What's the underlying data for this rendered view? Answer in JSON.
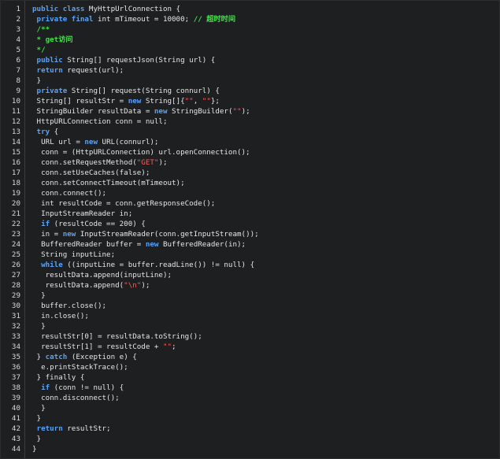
{
  "editor": {
    "lines": [
      [
        {
          "t": "public class",
          "c": "kw"
        },
        {
          "t": " MyHttpUrlConnection {",
          "c": "pl"
        }
      ],
      [
        {
          "t": " private final",
          "c": "kw"
        },
        {
          "t": " int mTimeout = 10000; ",
          "c": "pl"
        },
        {
          "t": "// 超时时间",
          "c": "cm"
        }
      ],
      [
        {
          "t": " /**",
          "c": "cm"
        }
      ],
      [
        {
          "t": " * get访问",
          "c": "cm"
        }
      ],
      [
        {
          "t": " */",
          "c": "cm"
        }
      ],
      [
        {
          "t": " public",
          "c": "kw"
        },
        {
          "t": " String[] requestJson(String url) {",
          "c": "pl"
        }
      ],
      [
        {
          "t": " return",
          "c": "kw"
        },
        {
          "t": " request(url);",
          "c": "pl"
        }
      ],
      [
        {
          "t": " }",
          "c": "pl"
        }
      ],
      [
        {
          "t": " private",
          "c": "kw"
        },
        {
          "t": " String[] request(String connurl) {",
          "c": "pl"
        }
      ],
      [
        {
          "t": " String[] resultStr = ",
          "c": "pl"
        },
        {
          "t": "new",
          "c": "kw"
        },
        {
          "t": " String[]{",
          "c": "pl"
        },
        {
          "t": "\"\"",
          "c": "st"
        },
        {
          "t": ", ",
          "c": "pl"
        },
        {
          "t": "\"\"",
          "c": "st"
        },
        {
          "t": "};",
          "c": "pl"
        }
      ],
      [
        {
          "t": " StringBuilder resultData = ",
          "c": "pl"
        },
        {
          "t": "new",
          "c": "kw"
        },
        {
          "t": " StringBuilder(",
          "c": "pl"
        },
        {
          "t": "\"\"",
          "c": "st"
        },
        {
          "t": ");",
          "c": "pl"
        }
      ],
      [
        {
          "t": " HttpURLConnection conn = null;",
          "c": "pl"
        }
      ],
      [
        {
          "t": " try",
          "c": "kw"
        },
        {
          "t": " {",
          "c": "pl"
        }
      ],
      [
        {
          "t": "  URL url = ",
          "c": "pl"
        },
        {
          "t": "new",
          "c": "kw"
        },
        {
          "t": " URL(connurl);",
          "c": "pl"
        }
      ],
      [
        {
          "t": "  conn = (HttpURLConnection) url.openConnection();",
          "c": "pl"
        }
      ],
      [
        {
          "t": "  conn.setRequestMethod(",
          "c": "pl"
        },
        {
          "t": "\"GET\"",
          "c": "st"
        },
        {
          "t": ");",
          "c": "pl"
        }
      ],
      [
        {
          "t": "  conn.setUseCaches(false);",
          "c": "pl"
        }
      ],
      [
        {
          "t": "  conn.setConnectTimeout(mTimeout);",
          "c": "pl"
        }
      ],
      [
        {
          "t": "  conn.connect();",
          "c": "pl"
        }
      ],
      [
        {
          "t": "  int resultCode = conn.getResponseCode();",
          "c": "pl"
        }
      ],
      [
        {
          "t": "  InputStreamReader in;",
          "c": "pl"
        }
      ],
      [
        {
          "t": "  if",
          "c": "kw"
        },
        {
          "t": " (resultCode == 200) {",
          "c": "pl"
        }
      ],
      [
        {
          "t": "  in = ",
          "c": "pl"
        },
        {
          "t": "new",
          "c": "kw"
        },
        {
          "t": " InputStreamReader(conn.getInputStream());",
          "c": "pl"
        }
      ],
      [
        {
          "t": "  BufferedReader buffer = ",
          "c": "pl"
        },
        {
          "t": "new",
          "c": "kw"
        },
        {
          "t": " BufferedReader(in);",
          "c": "pl"
        }
      ],
      [
        {
          "t": "  String inputLine;",
          "c": "pl"
        }
      ],
      [
        {
          "t": "  while",
          "c": "kw"
        },
        {
          "t": " ((inputLine = buffer.readLine()) != null) {",
          "c": "pl"
        }
      ],
      [
        {
          "t": "   resultData.append(inputLine);",
          "c": "pl"
        }
      ],
      [
        {
          "t": "   resultData.append(",
          "c": "pl"
        },
        {
          "t": "\"\\n\"",
          "c": "st"
        },
        {
          "t": ");",
          "c": "pl"
        }
      ],
      [
        {
          "t": "  }",
          "c": "pl"
        }
      ],
      [
        {
          "t": "  buffer.close();",
          "c": "pl"
        }
      ],
      [
        {
          "t": "  in.close();",
          "c": "pl"
        }
      ],
      [
        {
          "t": "  }",
          "c": "pl"
        }
      ],
      [
        {
          "t": "  resultStr[0] = resultData.toString();",
          "c": "pl"
        }
      ],
      [
        {
          "t": "  resultStr[1] = resultCode + ",
          "c": "pl"
        },
        {
          "t": "\"\"",
          "c": "st"
        },
        {
          "t": ";",
          "c": "pl"
        }
      ],
      [
        {
          "t": " } ",
          "c": "pl"
        },
        {
          "t": "catch",
          "c": "kw"
        },
        {
          "t": " (Exception e) {",
          "c": "pl"
        }
      ],
      [
        {
          "t": "  e.printStackTrace();",
          "c": "pl"
        }
      ],
      [
        {
          "t": " } finally {",
          "c": "pl"
        }
      ],
      [
        {
          "t": "  if",
          "c": "kw"
        },
        {
          "t": " (conn != null) {",
          "c": "pl"
        }
      ],
      [
        {
          "t": "  conn.disconnect();",
          "c": "pl"
        }
      ],
      [
        {
          "t": "  }",
          "c": "pl"
        }
      ],
      [
        {
          "t": " }",
          "c": "pl"
        }
      ],
      [
        {
          "t": " return",
          "c": "kw"
        },
        {
          "t": " resultStr;",
          "c": "pl"
        }
      ],
      [
        {
          "t": " }",
          "c": "pl"
        }
      ],
      [
        {
          "t": "}",
          "c": "pl"
        }
      ]
    ]
  },
  "colors": {
    "background": "#1d1f21",
    "keyword": "#5aa2f5",
    "comment": "#43e04a",
    "string": "#ff5b5b",
    "plain": "#e6e6e6",
    "line_number": "#d8d8d8"
  }
}
